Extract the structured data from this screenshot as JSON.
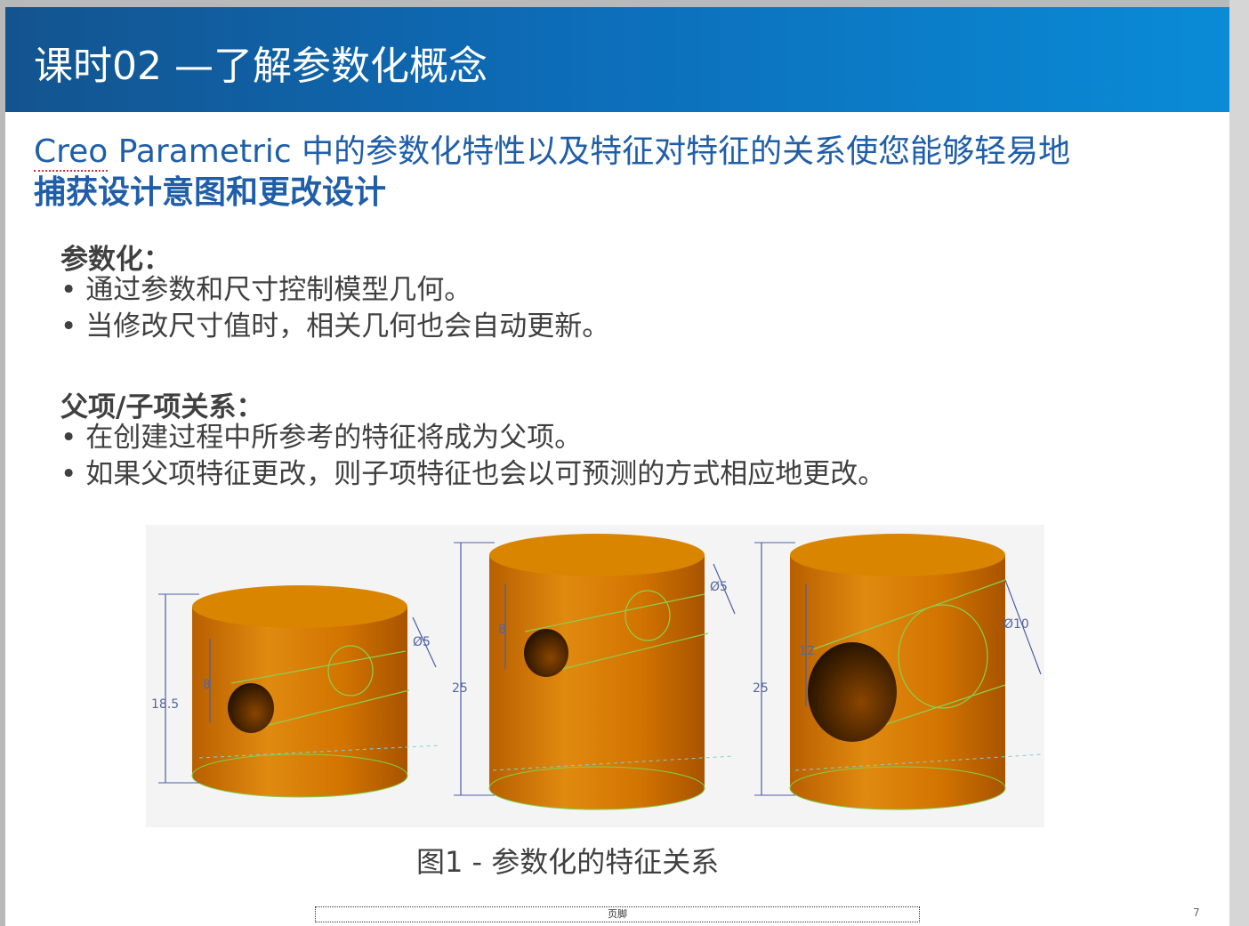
{
  "slide": {
    "title": "课时02 —了解参数化概念",
    "subtitle_line1_brand": "Creo",
    "subtitle_line1_rest": " Parametric 中的参数化特性以及特征对特征的关系使您能够轻易地",
    "subtitle_line2": "捕获设计意图和更改设计",
    "sections": [
      {
        "title": "参数化：",
        "bullets": [
          "通过参数和尺寸控制模型几何。",
          "当修改尺寸值时，相关几何也会自动更新。"
        ]
      },
      {
        "title": "父项/子项关系：",
        "bullets": [
          "在创建过程中所参考的特征将成为父项。",
          "如果父项特征更改，则子项特征也会以可预测的方式相应地更改。"
        ]
      }
    ],
    "figure": {
      "caption": "图1 - 参数化的特征关系",
      "models": [
        {
          "height_label": "18.5",
          "hole_offset_label": "8",
          "diameter_label": "Ø5"
        },
        {
          "height_label": "25",
          "hole_offset_label": "8",
          "diameter_label": "Ø5"
        },
        {
          "height_label": "25",
          "hole_offset_label": "12",
          "diameter_label": "Ø10"
        }
      ]
    },
    "footer_label": "页脚",
    "page_number": "7"
  },
  "colors": {
    "header_start": "#13548f",
    "header_end": "#0a8bd6",
    "subtitle": "#1f5ea8",
    "body_text": "#404040",
    "cylinder": "#d97a00"
  }
}
